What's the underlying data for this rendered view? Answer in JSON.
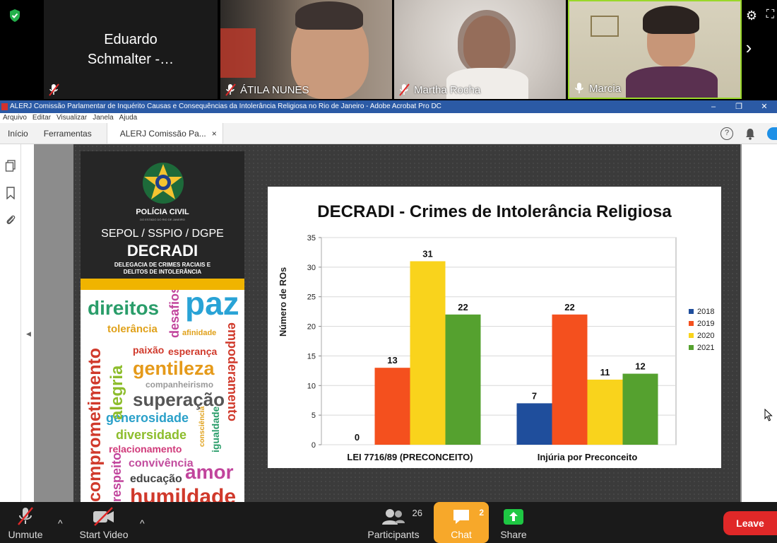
{
  "video_strip": {
    "tiles": [
      {
        "name": "Eduardo Schmalter -…",
        "muted": true
      },
      {
        "name": "ÁTILA NUNES",
        "muted": true
      },
      {
        "name": "Martha Rocha",
        "muted": true
      },
      {
        "name": "Marcia",
        "muted": false
      }
    ],
    "colors": {
      "active_speaker_border": "#9ad82a"
    }
  },
  "acrobat": {
    "title": "ALERJ Comissão Parlamentar de Inquérito Causas e Consequências da Intolerância Religiosa no Rio de Janeiro - Adobe Acrobat Pro DC",
    "window_buttons": [
      "–",
      "❐",
      "✕"
    ],
    "menu": [
      "Arquivo",
      "Editar",
      "Visualizar",
      "Janela",
      "Ajuda"
    ],
    "tabs": {
      "home": "Início",
      "tools": "Ferramentas",
      "document": "ALERJ Comissão Pa...",
      "close": "×"
    },
    "help_glyph": "?",
    "colors": {
      "title_bar": "#2b5aa5"
    }
  },
  "banner": {
    "org": "POLÍCIA CIVIL",
    "org_sub": "DO ESTADO DO RIO DE JANEIRO",
    "department": "SEPOL / SSPIO / DGPE",
    "unit": "DECRADI",
    "unit_desc_1": "DELEGACIA DE CRIMES RACIAIS E",
    "unit_desc_2": "DELITOS DE INTOLERÂNCIA",
    "words": {
      "direitos": "direitos",
      "paz": "paz",
      "desafios": "desafios",
      "tolerancia": "tolerância",
      "afinidade": "afinidade",
      "paixao": "paixão",
      "esperanca": "esperança",
      "gentileza": "gentileza",
      "companheirismo": "companheirismo",
      "superacao": "superação",
      "generosidade": "generosidade",
      "diversidade": "diversidade",
      "relacionamento": "relacionamento",
      "convivencia": "convivência",
      "educacao": "educação",
      "amor": "amor",
      "humildade": "humildade",
      "comprometimento": "comprometimento",
      "alegria": "alegria",
      "empoderamento": "empoderamento",
      "igualdade": "igualdade",
      "consciencia": "consciência",
      "respeito": "respeito"
    }
  },
  "chart_data": {
    "type": "bar",
    "title": "DECRADI - Crimes de Intolerância Religiosa",
    "ylabel": "Número de ROs",
    "xlabel": "",
    "categories": [
      "LEI 7716/89 (PRECONCEITO)",
      "Injúria por Preconceito"
    ],
    "series": [
      {
        "name": "2018",
        "color": "#1f4e9c",
        "values": [
          0,
          7
        ]
      },
      {
        "name": "2019",
        "color": "#f4501e",
        "values": [
          13,
          22
        ]
      },
      {
        "name": "2020",
        "color": "#f9d31c",
        "values": [
          31,
          11
        ]
      },
      {
        "name": "2021",
        "color": "#55a12f",
        "values": [
          22,
          12
        ]
      }
    ],
    "ylim": [
      0,
      35
    ],
    "yticks": [
      0,
      5,
      10,
      15,
      20,
      25,
      30,
      35
    ],
    "grid": true,
    "legend_position": "right",
    "data_labels": true
  },
  "toolbar": {
    "unmute": "Unmute",
    "start_video": "Start Video",
    "participants": "Participants",
    "participants_count": "26",
    "chat": "Chat",
    "chat_count": "2",
    "share": "Share",
    "leave": "Leave",
    "caret": "^",
    "colors": {
      "chat_highlight": "#f7a82a",
      "leave": "#e02828",
      "share": "#1ec743"
    }
  }
}
